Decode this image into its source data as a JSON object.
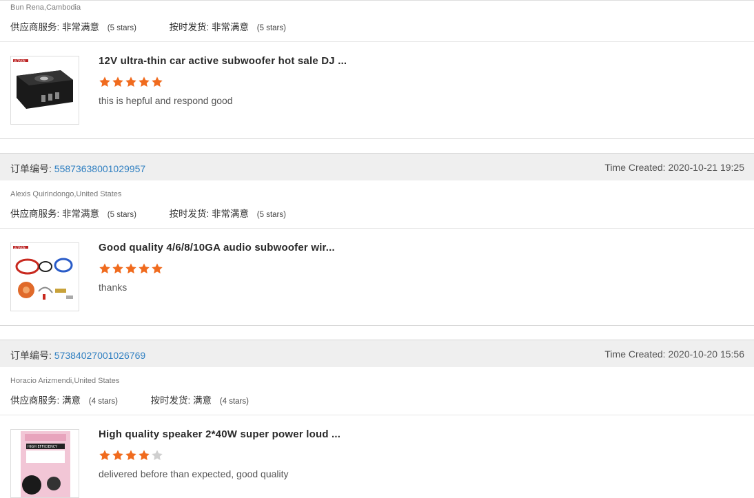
{
  "orders": [
    {
      "buyer": "Bun Rena,Cambodia",
      "service_label": "供应商服务:",
      "service_value": "非常满意",
      "service_stars": "(5 stars)",
      "shipping_label": "按时发货:",
      "shipping_value": "非常满意",
      "shipping_stars": "(5 stars)",
      "product_title": "12V ultra-thin car active subwoofer hot sale DJ ...",
      "rating": 5,
      "comment": "this is hepful and respond good",
      "thumb_icon": "subwoofer-box-image"
    },
    {
      "order_label": "订单编号:",
      "order_number": "55873638001029957",
      "time_created": "Time Created: 2020-10-21 19:25",
      "buyer": "Alexis Quirindongo,United States",
      "service_label": "供应商服务:",
      "service_value": "非常满意",
      "service_stars": "(5 stars)",
      "shipping_label": "按时发货:",
      "shipping_value": "非常满意",
      "shipping_stars": "(5 stars)",
      "product_title": "Good quality 4/6/8/10GA audio subwoofer wir...",
      "rating": 5,
      "comment": "thanks",
      "thumb_icon": "wiring-kit-image"
    },
    {
      "order_label": "订单编号:",
      "order_number": "57384027001026769",
      "time_created": "Time Created: 2020-10-20 15:56",
      "buyer": "Horacio Arizmendi,United States",
      "service_label": "供应商服务:",
      "service_value": "满意",
      "service_stars": "(4 stars)",
      "shipping_label": "按时发货:",
      "shipping_value": "满意",
      "shipping_stars": "(4 stars)",
      "product_title": "High quality speaker 2*40W super power loud ...",
      "rating": 4,
      "comment": "delivered before than expected, good quality",
      "thumb_icon": "tweeter-package-image"
    }
  ],
  "colors": {
    "star_filled": "#f06b1e",
    "star_empty": "#cfcfcf",
    "link": "#2f7fc1",
    "header_bg": "#efefef"
  }
}
